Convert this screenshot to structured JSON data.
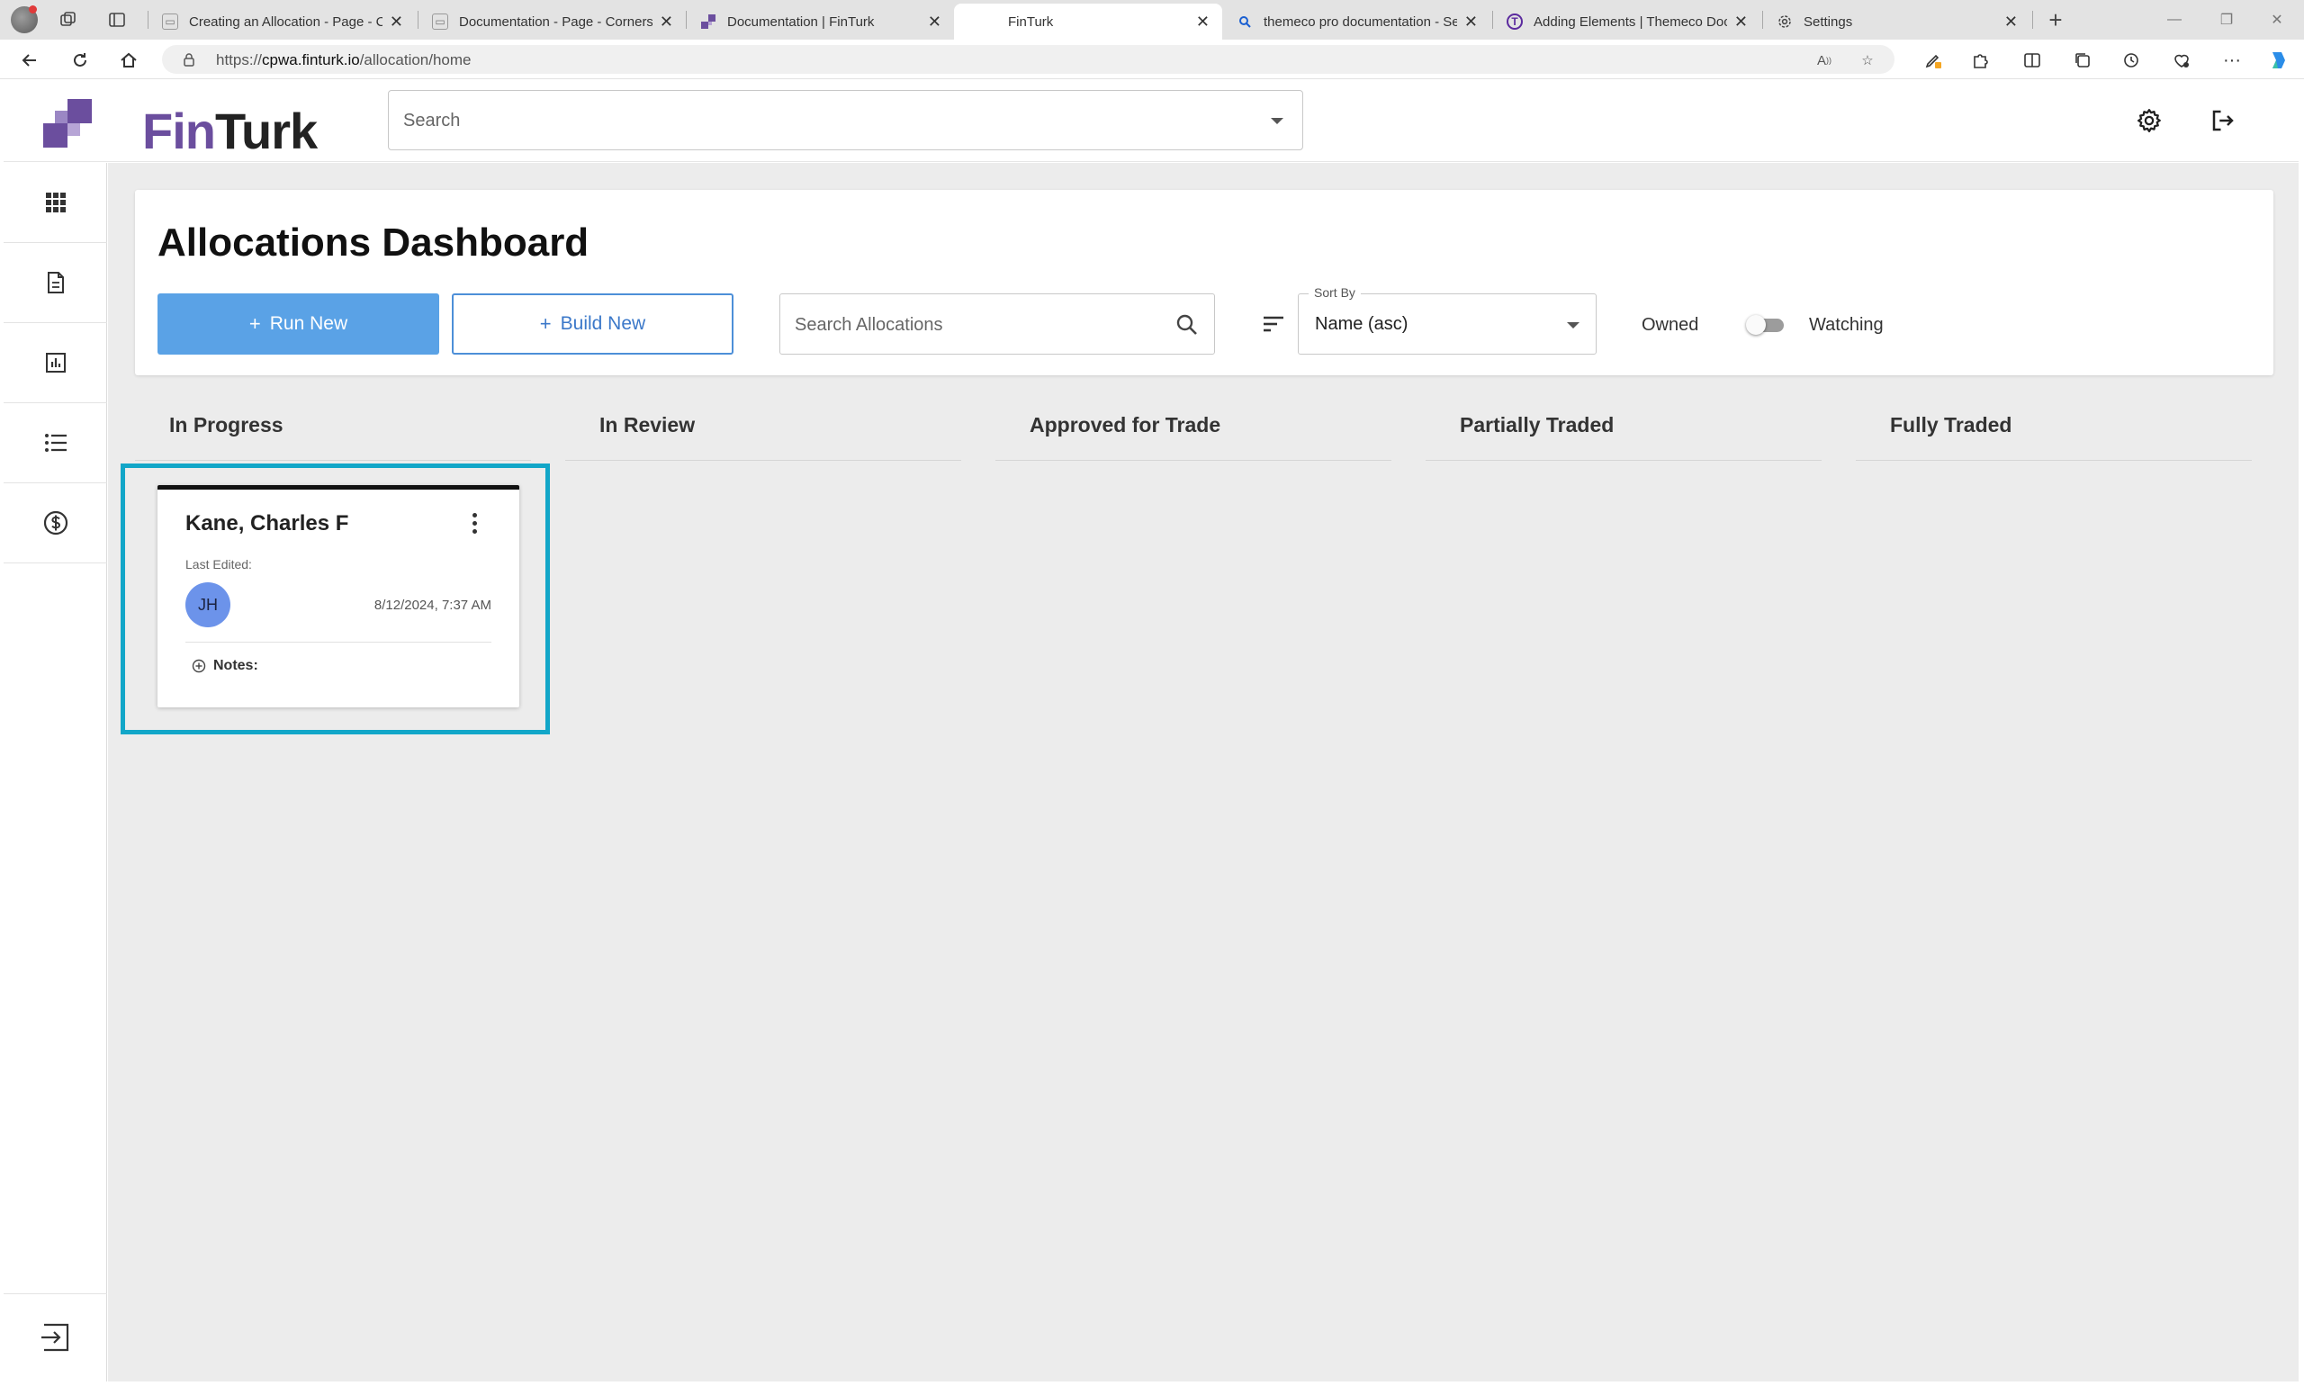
{
  "browser": {
    "tabs": [
      {
        "title": "Creating an Allocation - Page - C",
        "active": false
      },
      {
        "title": "Documentation - Page - Cornerst",
        "active": false
      },
      {
        "title": "Documentation | FinTurk",
        "active": false
      },
      {
        "title": "FinTurk",
        "active": true
      },
      {
        "title": "themeco pro documentation - Se",
        "active": false
      },
      {
        "title": "Adding Elements | Themeco Doc",
        "active": false
      },
      {
        "title": "Settings",
        "active": false
      }
    ],
    "url_prefix": "https://",
    "url_host": "cpwa.finturk.io",
    "url_path": "/allocation/home"
  },
  "app": {
    "logo_fin": "Fin",
    "logo_turk": "Turk",
    "search_placeholder": "Search",
    "header_icons": [
      "gear-icon",
      "logout-icon"
    ]
  },
  "sidebar": {
    "items": [
      "apps-grid-icon",
      "document-icon",
      "chart-icon",
      "list-icon",
      "dollar-icon"
    ],
    "bottom": "sign-in-icon"
  },
  "dashboard": {
    "title": "Allocations Dashboard",
    "run_new_label": "Run New",
    "build_new_label": "Build New",
    "search_placeholder": "Search Allocations",
    "sort_by_label": "Sort By",
    "sort_value": "Name (asc)",
    "owned_label": "Owned",
    "watching_label": "Watching",
    "watching_toggle_on": false
  },
  "columns": [
    "In Progress",
    "In Review",
    "Approved for Trade",
    "Partially Traded",
    "Fully Traded"
  ],
  "cards": [
    {
      "client_name": "Kane, Charles F",
      "last_edited_label": "Last Edited:",
      "editor_initials": "JH",
      "edited_at": "8/12/2024, 7:37 AM",
      "notes_label": "Notes:",
      "column": "In Progress"
    }
  ],
  "colors": {
    "brand_purple": "#6b4e9e",
    "primary_blue": "#5aa2e6",
    "highlight_cyan": "#12a6c8",
    "avatar_blue": "#6c93ea"
  }
}
